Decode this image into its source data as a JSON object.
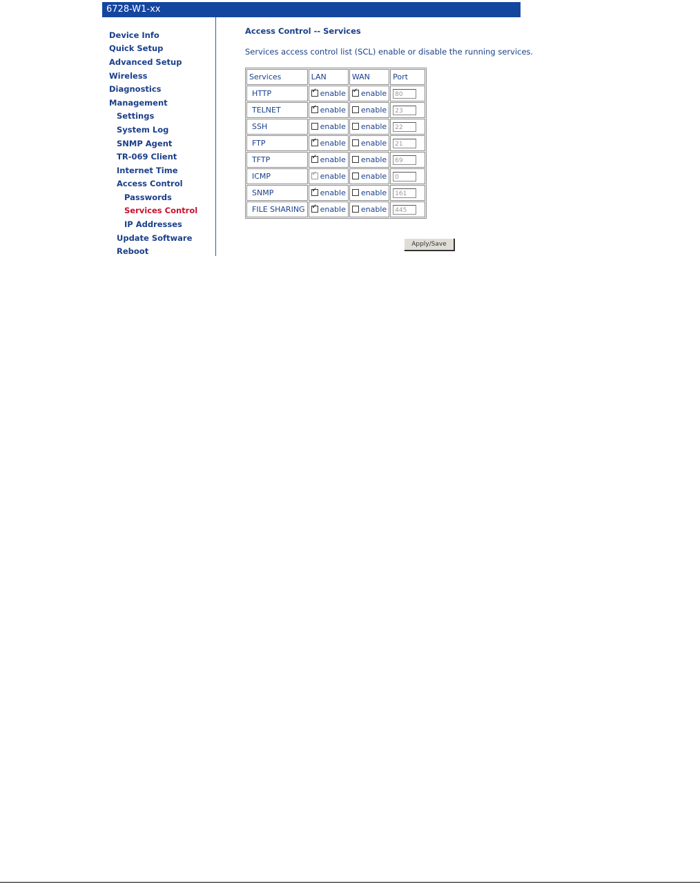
{
  "header": {
    "title": "6728-W1-xx"
  },
  "sidebar": {
    "items": [
      {
        "label": "Device Info"
      },
      {
        "label": "Quick Setup"
      },
      {
        "label": "Advanced Setup"
      },
      {
        "label": "Wireless"
      },
      {
        "label": "Diagnostics"
      },
      {
        "label": "Management"
      },
      {
        "label": "Settings"
      },
      {
        "label": "System Log"
      },
      {
        "label": "SNMP Agent"
      },
      {
        "label": "TR-069 Client"
      },
      {
        "label": "Internet Time"
      },
      {
        "label": "Access Control"
      },
      {
        "label": "Passwords"
      },
      {
        "label": "Services Control"
      },
      {
        "label": "IP Addresses"
      },
      {
        "label": "Update Software"
      },
      {
        "label": "Reboot"
      }
    ]
  },
  "main": {
    "title": "Access Control -- Services",
    "description": "Services access control list (SCL) enable or disable the running services.",
    "table": {
      "headers": [
        "Services",
        "LAN",
        "WAN",
        "Port"
      ],
      "enable_label": "enable",
      "rows": [
        {
          "service": "HTTP",
          "lan": true,
          "wan": true,
          "port": "80"
        },
        {
          "service": "TELNET",
          "lan": true,
          "wan": false,
          "port": "23"
        },
        {
          "service": "SSH",
          "lan": false,
          "wan": false,
          "port": "22"
        },
        {
          "service": "FTP",
          "lan": true,
          "wan": false,
          "port": "21"
        },
        {
          "service": "TFTP",
          "lan": true,
          "wan": false,
          "port": "69"
        },
        {
          "service": "ICMP",
          "lan": true,
          "wan": false,
          "port": "0",
          "lan_disabled": true
        },
        {
          "service": "SNMP",
          "lan": true,
          "wan": false,
          "port": "161"
        },
        {
          "service": "FILE SHARING",
          "lan": true,
          "wan": false,
          "port": "445"
        }
      ]
    },
    "apply_label": "Apply/Save"
  },
  "colors": {
    "header_bg": "#1446a0",
    "link": "#1a3f8a",
    "active_link": "#c8102e"
  }
}
